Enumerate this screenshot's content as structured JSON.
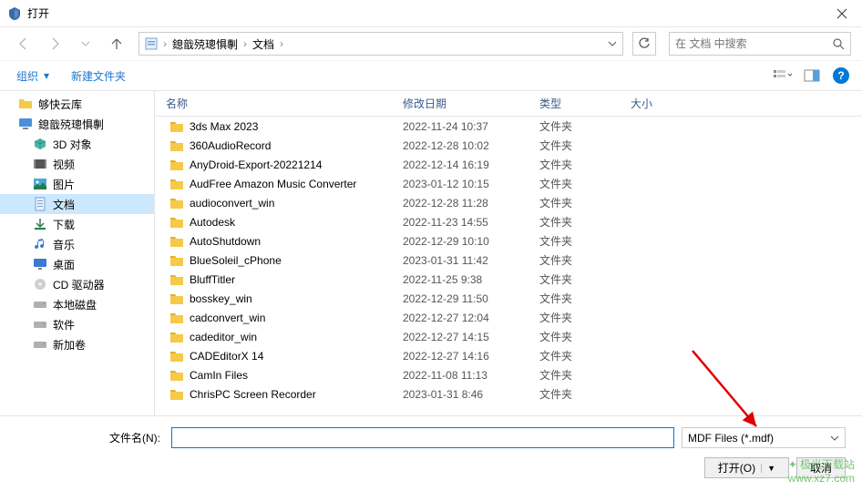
{
  "window": {
    "title": "打开",
    "close_tooltip": "关闭"
  },
  "nav": {
    "breadcrumb": [
      "鎴戠殑璁惧剸",
      "文档"
    ],
    "search_placeholder": "在 文档 中搜索"
  },
  "toolbar": {
    "organize": "组织",
    "new_folder": "新建文件夹"
  },
  "sidebar": {
    "items": [
      {
        "label": "够快云库",
        "icon": "folder-yellow",
        "indent": false
      },
      {
        "label": "鎴戠殑璁惧剸",
        "icon": "monitor",
        "indent": false
      },
      {
        "label": "3D 对象",
        "icon": "cube-3d",
        "indent": true
      },
      {
        "label": "视频",
        "icon": "video",
        "indent": true
      },
      {
        "label": "图片",
        "icon": "picture",
        "indent": true
      },
      {
        "label": "文档",
        "icon": "document",
        "indent": true,
        "selected": true
      },
      {
        "label": "下载",
        "icon": "download",
        "indent": true
      },
      {
        "label": "音乐",
        "icon": "music",
        "indent": true
      },
      {
        "label": "桌面",
        "icon": "desktop",
        "indent": true
      },
      {
        "label": "CD 驱动器",
        "icon": "cd",
        "indent": true
      },
      {
        "label": "本地磁盘",
        "icon": "disk",
        "indent": true
      },
      {
        "label": "软件",
        "icon": "disk",
        "indent": true
      },
      {
        "label": "新加卷",
        "icon": "disk",
        "indent": true
      }
    ]
  },
  "columns": {
    "name": "名称",
    "date": "修改日期",
    "type": "类型",
    "size": "大小"
  },
  "files": [
    {
      "name": "3ds Max 2023",
      "date": "2022-11-24 10:37",
      "type": "文件夹"
    },
    {
      "name": "360AudioRecord",
      "date": "2022-12-28 10:02",
      "type": "文件夹"
    },
    {
      "name": "AnyDroid-Export-20221214",
      "date": "2022-12-14 16:19",
      "type": "文件夹"
    },
    {
      "name": "AudFree Amazon Music Converter",
      "date": "2023-01-12 10:15",
      "type": "文件夹"
    },
    {
      "name": "audioconvert_win",
      "date": "2022-12-28 11:28",
      "type": "文件夹"
    },
    {
      "name": "Autodesk",
      "date": "2022-11-23 14:55",
      "type": "文件夹"
    },
    {
      "name": "AutoShutdown",
      "date": "2022-12-29 10:10",
      "type": "文件夹"
    },
    {
      "name": "BlueSoleil_cPhone",
      "date": "2023-01-31 11:42",
      "type": "文件夹"
    },
    {
      "name": "BluffTitler",
      "date": "2022-11-25 9:38",
      "type": "文件夹"
    },
    {
      "name": "bosskey_win",
      "date": "2022-12-29 11:50",
      "type": "文件夹"
    },
    {
      "name": "cadconvert_win",
      "date": "2022-12-27 12:04",
      "type": "文件夹"
    },
    {
      "name": "cadeditor_win",
      "date": "2022-12-27 14:15",
      "type": "文件夹"
    },
    {
      "name": "CADEditorX 14",
      "date": "2022-12-27 14:16",
      "type": "文件夹"
    },
    {
      "name": "CamIn Files",
      "date": "2022-11-08 11:13",
      "type": "文件夹"
    },
    {
      "name": "ChrisPC Screen Recorder",
      "date": "2023-01-31 8:46",
      "type": "文件夹"
    }
  ],
  "bottom": {
    "filename_label": "文件名(N):",
    "filename_value": "",
    "filetype": "MDF Files (*.mdf)",
    "open_button": "打开(O)",
    "cancel_button": "取消"
  },
  "watermark": {
    "line1": "极光下载站",
    "line2": "www.xz7.com"
  }
}
